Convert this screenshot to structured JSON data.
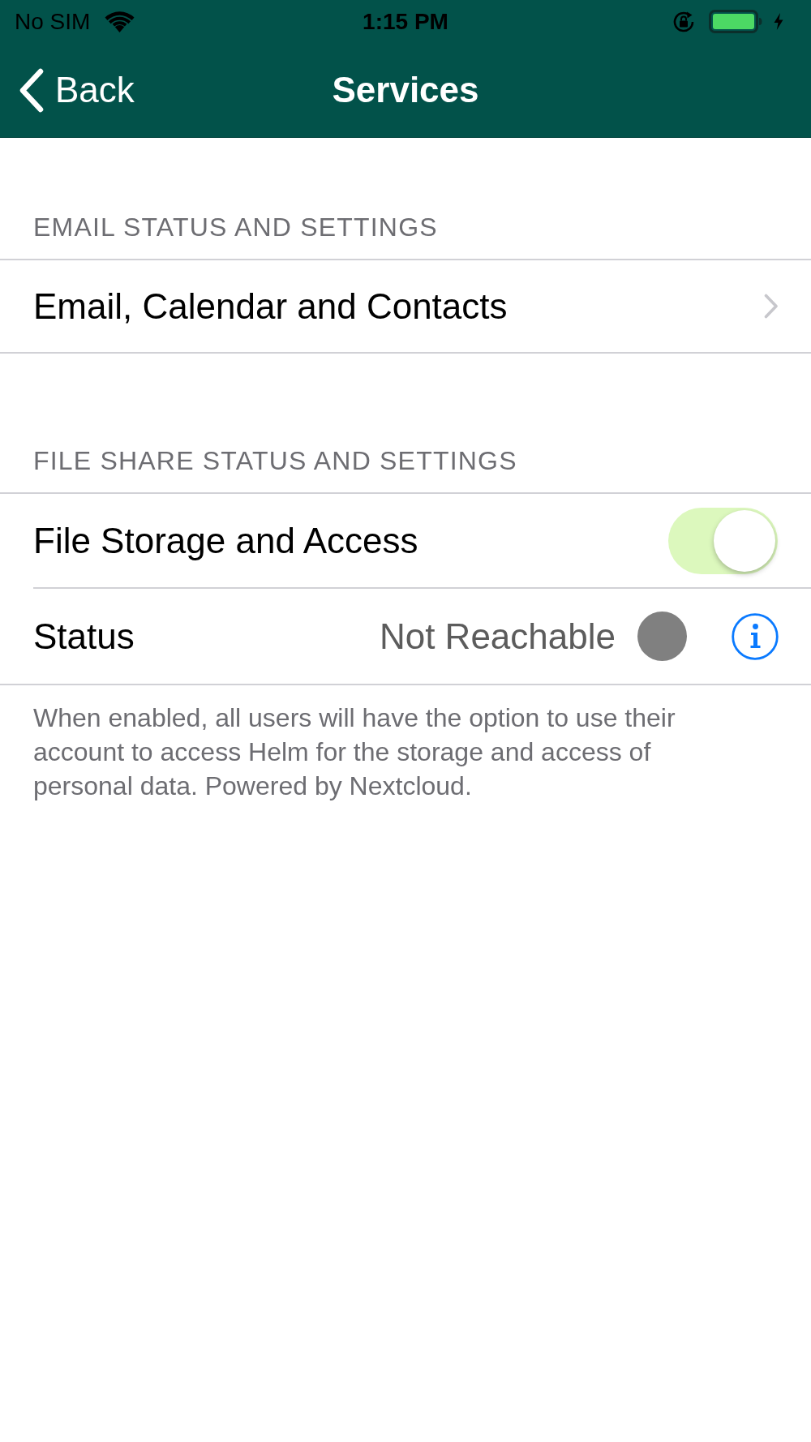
{
  "status_bar": {
    "carrier": "No SIM",
    "time": "1:15 PM"
  },
  "nav": {
    "back": "Back",
    "title": "Services"
  },
  "sections": [
    {
      "header": "EMAIL STATUS AND SETTINGS",
      "rows": [
        {
          "kind": "link",
          "label": "Email, Calendar and Contacts"
        }
      ]
    },
    {
      "header": "FILE SHARE STATUS AND SETTINGS",
      "rows": [
        {
          "kind": "toggle",
          "label": "File Storage and Access",
          "on": true
        },
        {
          "kind": "status",
          "label": "Status",
          "value": "Not Reachable",
          "color": "#808080"
        }
      ],
      "footer": "When enabled, all users will have the option to use their account to access Helm for the storage and access of personal data. Powered by Nextcloud."
    }
  ]
}
